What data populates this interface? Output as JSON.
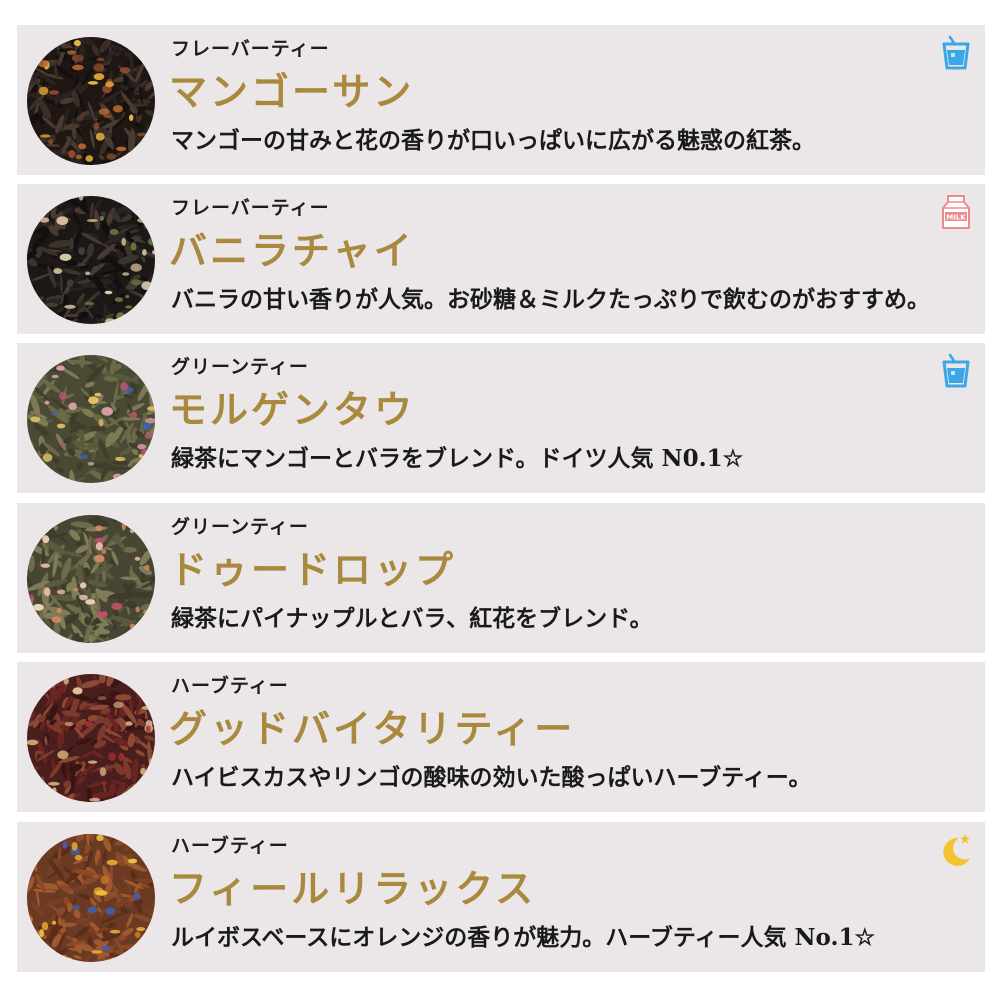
{
  "colors": {
    "card_background": "#ebe6e8",
    "name_gold": "#a8893e",
    "text_dark": "#1a1a1a",
    "iced_icon": "#3ba7e6",
    "milk_icon": "#f08a8a",
    "night_icon": "#f2c230"
  },
  "items": [
    {
      "category": "フレーバーティー",
      "name": "マンゴーサン",
      "description": "マンゴーの甘みと花の香りが口いっぱいに広がる魅惑の紅茶。",
      "badge_icon": "iced-drink-icon",
      "image": "black-tea-with-mango-and-marigold"
    },
    {
      "category": "フレーバーティー",
      "name": "バニラチャイ",
      "description": "バニラの甘い香りが人気。お砂糖＆ミルクたっぷりで飲むのがおすすめ。",
      "badge_icon": "milk-carton-icon",
      "badge_text": "MILK",
      "image": "black-tea-with-cardamom"
    },
    {
      "category": "グリーンティー",
      "name": "モルゲンタウ",
      "description": "緑茶にマンゴーとバラをブレンド。ドイツ人気 N0.1☆",
      "badge_icon": "iced-drink-icon",
      "image": "green-tea-with-cornflower-and-rose"
    },
    {
      "category": "グリーンティー",
      "name": "ドゥードロップ",
      "description": "緑茶にパイナップルとバラ、紅花をブレンド。",
      "badge_icon": "",
      "image": "green-tea-with-rose-and-pineapple"
    },
    {
      "category": "ハーブティー",
      "name": "グッドバイタリティー",
      "description": "ハイビスカスやリンゴの酸味の効いた酸っぱいハーブティー。",
      "badge_icon": "",
      "image": "hibiscus-and-apple-herbal-blend"
    },
    {
      "category": "ハーブティー",
      "name": "フィールリラックス",
      "description": "ルイボスベースにオレンジの香りが魅力。ハーブティー人気 No.1☆",
      "badge_icon": "moon-star-icon",
      "image": "rooibos-with-orange-and-cornflower"
    }
  ]
}
